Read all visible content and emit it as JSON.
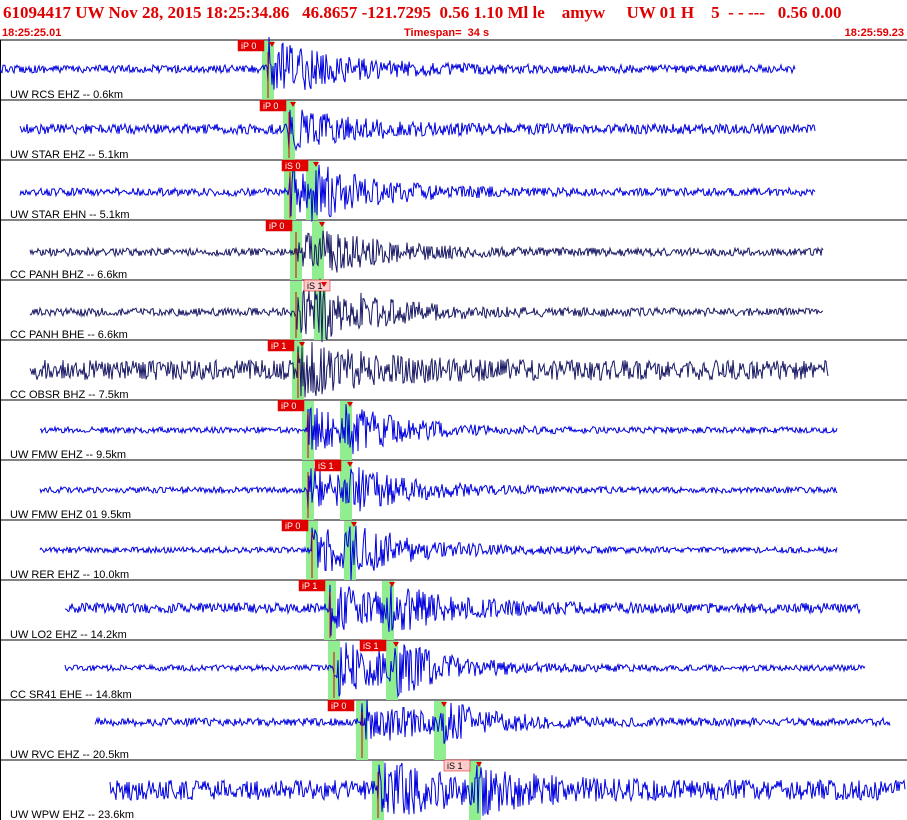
{
  "header": {
    "title": "61094417 UW Nov 28, 2015 18:25:34.86   46.8657 -121.7295  0.56 1.10 Ml le    amyw     UW 01 H    5  - - ---   0.56 0.00",
    "start_time": "18:25:25.01",
    "timespan": "Timespan=  34 s",
    "end_time": "18:25:59.23"
  },
  "colors": {
    "title": "#e00000",
    "trace_main": "#0000e0",
    "trace_dark": "#1a1a66",
    "pick_flag": "#e00000",
    "pick_flag_light": "#ffcccc",
    "phase_window": "#90ee90",
    "divider": "#000000"
  },
  "channels": [
    {
      "label": "UW RCS EHZ -- 0.6km",
      "color": "trace_main",
      "pick": "iP 0",
      "pick_style": "red"
    },
    {
      "label": "UW STAR EHZ -- 5.1km",
      "color": "trace_main",
      "pick": "iP 0",
      "pick_style": "red"
    },
    {
      "label": "UW STAR EHN -- 5.1km",
      "color": "trace_main",
      "pick": "iS 0",
      "pick_style": "red"
    },
    {
      "label": "CC PANH BHZ -- 6.6km",
      "color": "trace_dark",
      "pick": "iP 0",
      "pick_style": "red"
    },
    {
      "label": "CC PANH BHE -- 6.6km",
      "color": "trace_dark",
      "pick": "iS 1",
      "pick_style": "light"
    },
    {
      "label": "CC OBSR BHZ -- 7.5km",
      "color": "trace_dark",
      "pick": "iP 1",
      "pick_style": "red"
    },
    {
      "label": "UW FMW EHZ -- 9.5km",
      "color": "trace_main",
      "pick": "iP 0",
      "pick_style": "red"
    },
    {
      "label": "UW FMW EHZ 01 9.5km",
      "color": "trace_main",
      "pick": "iS 1",
      "pick_style": "red"
    },
    {
      "label": "UW RER EHZ -- 10.0km",
      "color": "trace_main",
      "pick": "iP 0",
      "pick_style": "red"
    },
    {
      "label": "UW LO2 EHZ -- 14.2km",
      "color": "trace_main",
      "pick": "iP 1",
      "pick_style": "red"
    },
    {
      "label": "CC SR41 EHE -- 14.8km",
      "color": "trace_main",
      "pick": "iS 1",
      "pick_style": "red"
    },
    {
      "label": "UW RVC EHZ -- 20.5km",
      "color": "trace_main",
      "pick": "iP 0",
      "pick_style": "red"
    },
    {
      "label": "UW WPW EHZ -- 23.6km",
      "color": "trace_main",
      "pick": "iS 1",
      "pick_style": "light"
    }
  ]
}
